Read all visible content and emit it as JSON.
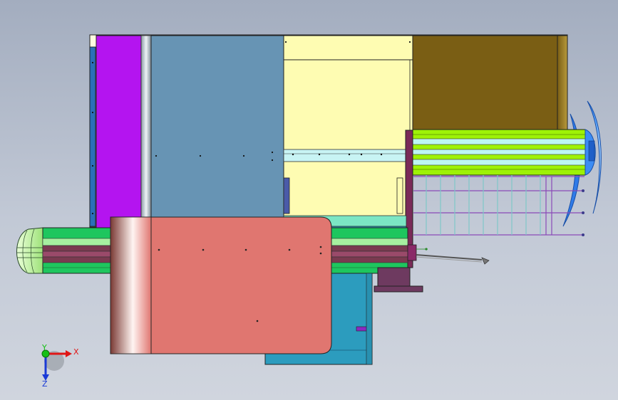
{
  "view": {
    "background_top": "#a3adbf",
    "background_bottom": "#d0d5de"
  },
  "model": {
    "colors": {
      "purple_panel": "#b414f0",
      "steel_blue_panel": "#6794b4",
      "light_yellow_panel": "#fefcb2",
      "olive_box": "#7a5e14",
      "lime_coil": "#9ef206",
      "cyan_lines": "#bdf7f2",
      "salmon_door": "#e07670",
      "teal_box": "#2c9cbe",
      "green_roller": "#1ec65e",
      "maroon_band": "#7a3a50",
      "blue_fan": "#3c8cf4",
      "mint_strip": "#7ce6c4",
      "grey_cylinder": "#aeb6bd",
      "dark_plum": "#6e3a60"
    }
  },
  "triad": {
    "x_label": "X",
    "y_label": "Y",
    "z_label": "Z",
    "x_color": "#e01616",
    "y_color": "#16c016",
    "z_color": "#1a3ad6"
  }
}
